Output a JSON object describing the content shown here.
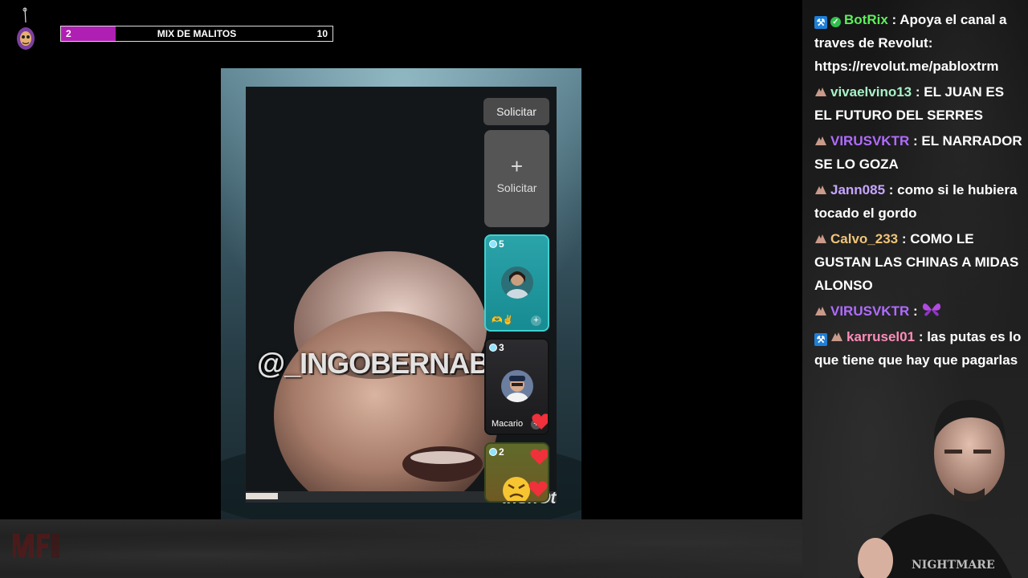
{
  "stream_overlay": {
    "progress": {
      "start": "2",
      "title": "MIX DE MALITOS",
      "end": "10",
      "fraction": 0.2
    }
  },
  "video": {
    "watermark": "@_INGOBERNABL3_",
    "editor_mark": "InShOt",
    "request_button": "Solicitar",
    "add_slot": {
      "plus": "+",
      "label": "Solicitar"
    },
    "slots": [
      {
        "count": "5",
        "name": "",
        "accent": "#3fd0cf"
      },
      {
        "count": "3",
        "name": "Macario",
        "accent": "#111111"
      },
      {
        "count": "2",
        "name": "",
        "accent": "#3a4a20"
      }
    ]
  },
  "chat": {
    "messages": [
      {
        "user": "BotRix",
        "text": ": Apoya el canal a traves de Revolut: https://revolut.me/pabloxtrm",
        "color": "#5df05a",
        "badges": [
          "mod-icon",
          "verified-icon"
        ]
      },
      {
        "user": "vivaelvino13",
        "text": ": EL JUAN ES EL FUTURO DEL SERRES",
        "color": "#a8f2c7",
        "badges": [
          "sub-badge-icon"
        ]
      },
      {
        "user": "VIRUSVKTR",
        "text": ": EL NARRADOR SE LO GOZA",
        "color": "#b06cff",
        "badges": [
          "sub-badge-icon"
        ]
      },
      {
        "user": "Jann085",
        "text": ": como si le hubiera tocado el gordo",
        "color": "#c6a6ff",
        "badges": [
          "sub-badge-icon"
        ]
      },
      {
        "user": "Calvo_233",
        "text": ": COMO LE GUSTAN LAS CHINAS A MIDAS ALONSO",
        "color": "#f1c47a",
        "badges": [
          "sub-badge-icon"
        ]
      },
      {
        "user": "VIRUSVKTR",
        "text": ":",
        "color": "#b06cff",
        "badges": [
          "sub-badge-icon"
        ],
        "emote": "purple-butterfly-emote"
      },
      {
        "user": "karrusel01",
        "text": ": las putas es lo que tiene que hay que pagarlas",
        "color": "#ff8db8",
        "badges": [
          "mod-icon",
          "sub-badge-icon"
        ]
      }
    ]
  },
  "colors": {
    "progress_fill": "#b01fb3",
    "background": "#000000"
  }
}
